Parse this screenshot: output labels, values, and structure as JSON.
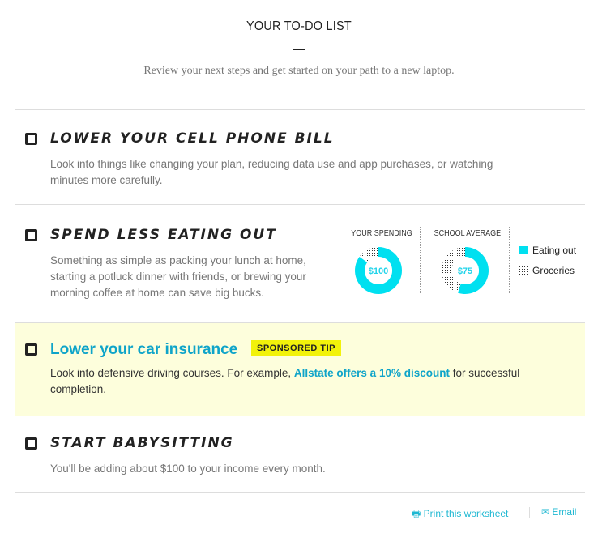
{
  "header": {
    "title": "YOUR TO-DO LIST",
    "subtitle": "Review your next steps and get started on your path to a new laptop."
  },
  "items": [
    {
      "title": "Lower your cell phone bill",
      "description": "Look into things like changing your plan, reducing data use and app purchases, or watching minutes more carefully."
    },
    {
      "title": "Spend less eating out",
      "description": "Something as simple as packing your lunch at home, starting a potluck dinner with friends, or brewing your morning coffee at home can save big bucks."
    },
    {
      "title": "Lower your car insurance",
      "badge": "SPONSORED TIP",
      "desc_pre": "Look into defensive driving courses. For example, ",
      "link": "Allstate offers a 10% discount",
      "desc_post": " for successful completion."
    },
    {
      "title": "Start babysitting",
      "description": "You'll be adding about $100 to your income every month."
    }
  ],
  "chart_data": [
    {
      "type": "pie",
      "title": "YOUR SPENDING",
      "center_label": "$100",
      "series": [
        {
          "name": "Eating out",
          "value": 0.85
        },
        {
          "name": "Groceries",
          "value": 0.15
        }
      ]
    },
    {
      "type": "pie",
      "title": "SCHOOL AVERAGE",
      "center_label": "$75",
      "series": [
        {
          "name": "Eating out",
          "value": 0.55
        },
        {
          "name": "Groceries",
          "value": 0.45
        }
      ]
    }
  ],
  "legend": [
    "Eating out",
    "Groceries"
  ],
  "colors": {
    "accent": "#00e0f0",
    "link": "#0ea4c9",
    "badge": "#f2f20a"
  },
  "footer": {
    "print": "Print this worksheet",
    "email": "Email"
  }
}
